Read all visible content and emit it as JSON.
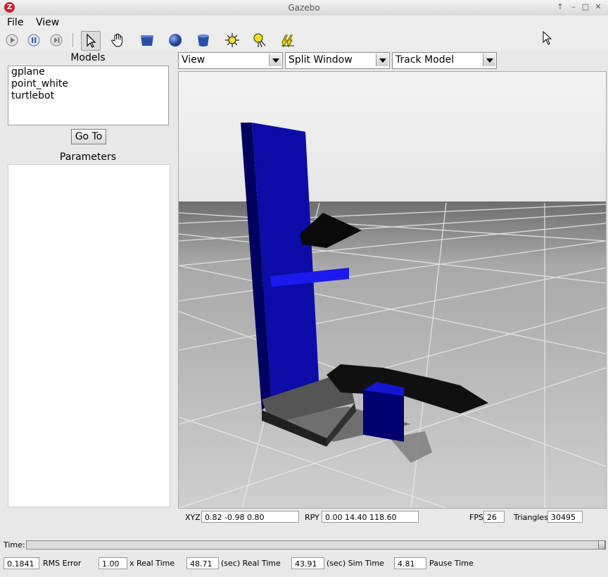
{
  "window": {
    "title": "Gazebo"
  },
  "menu": {
    "file": "File",
    "view": "View"
  },
  "toolbar": {
    "items": [
      "play-icon",
      "pause-icon",
      "step-icon",
      "select-arrow-icon",
      "hand-pan-icon",
      "box-icon",
      "sphere-icon",
      "cylinder-icon",
      "point-light-icon",
      "spot-light-icon",
      "directional-light-icon"
    ]
  },
  "left": {
    "models_label": "Models",
    "models": [
      "gplane",
      "point_white",
      "turtlebot"
    ],
    "goto_label": "Go To",
    "params_label": "Parameters"
  },
  "view_controls": {
    "view_select": "View",
    "split_select": "Split Window",
    "track_select": "Track Model"
  },
  "status": {
    "xyz_label": "XYZ",
    "xyz_value": "0.82  -0.98   0.80",
    "rpy_label": "RPY",
    "rpy_value": "0.00  14.40 118.60",
    "fps_label": "FPS",
    "fps_value": "26",
    "triangles_label": "Triangles",
    "triangles_value": "30495"
  },
  "time": {
    "label": "Time:",
    "rms_value": "0.1841",
    "rms_label": "RMS Error",
    "rt_factor_value": "1.00",
    "rt_factor_label": "x Real Time",
    "real_time_value": "48.71",
    "real_time_label": "(sec) Real Time",
    "sim_time_value": "43.91",
    "sim_time_label": "(sec) Sim Time",
    "pause_value": "4.81",
    "pause_label": "Pause Time"
  },
  "colors": {
    "robot_blue": "#1010c8",
    "floor": "#c8c8c8"
  }
}
